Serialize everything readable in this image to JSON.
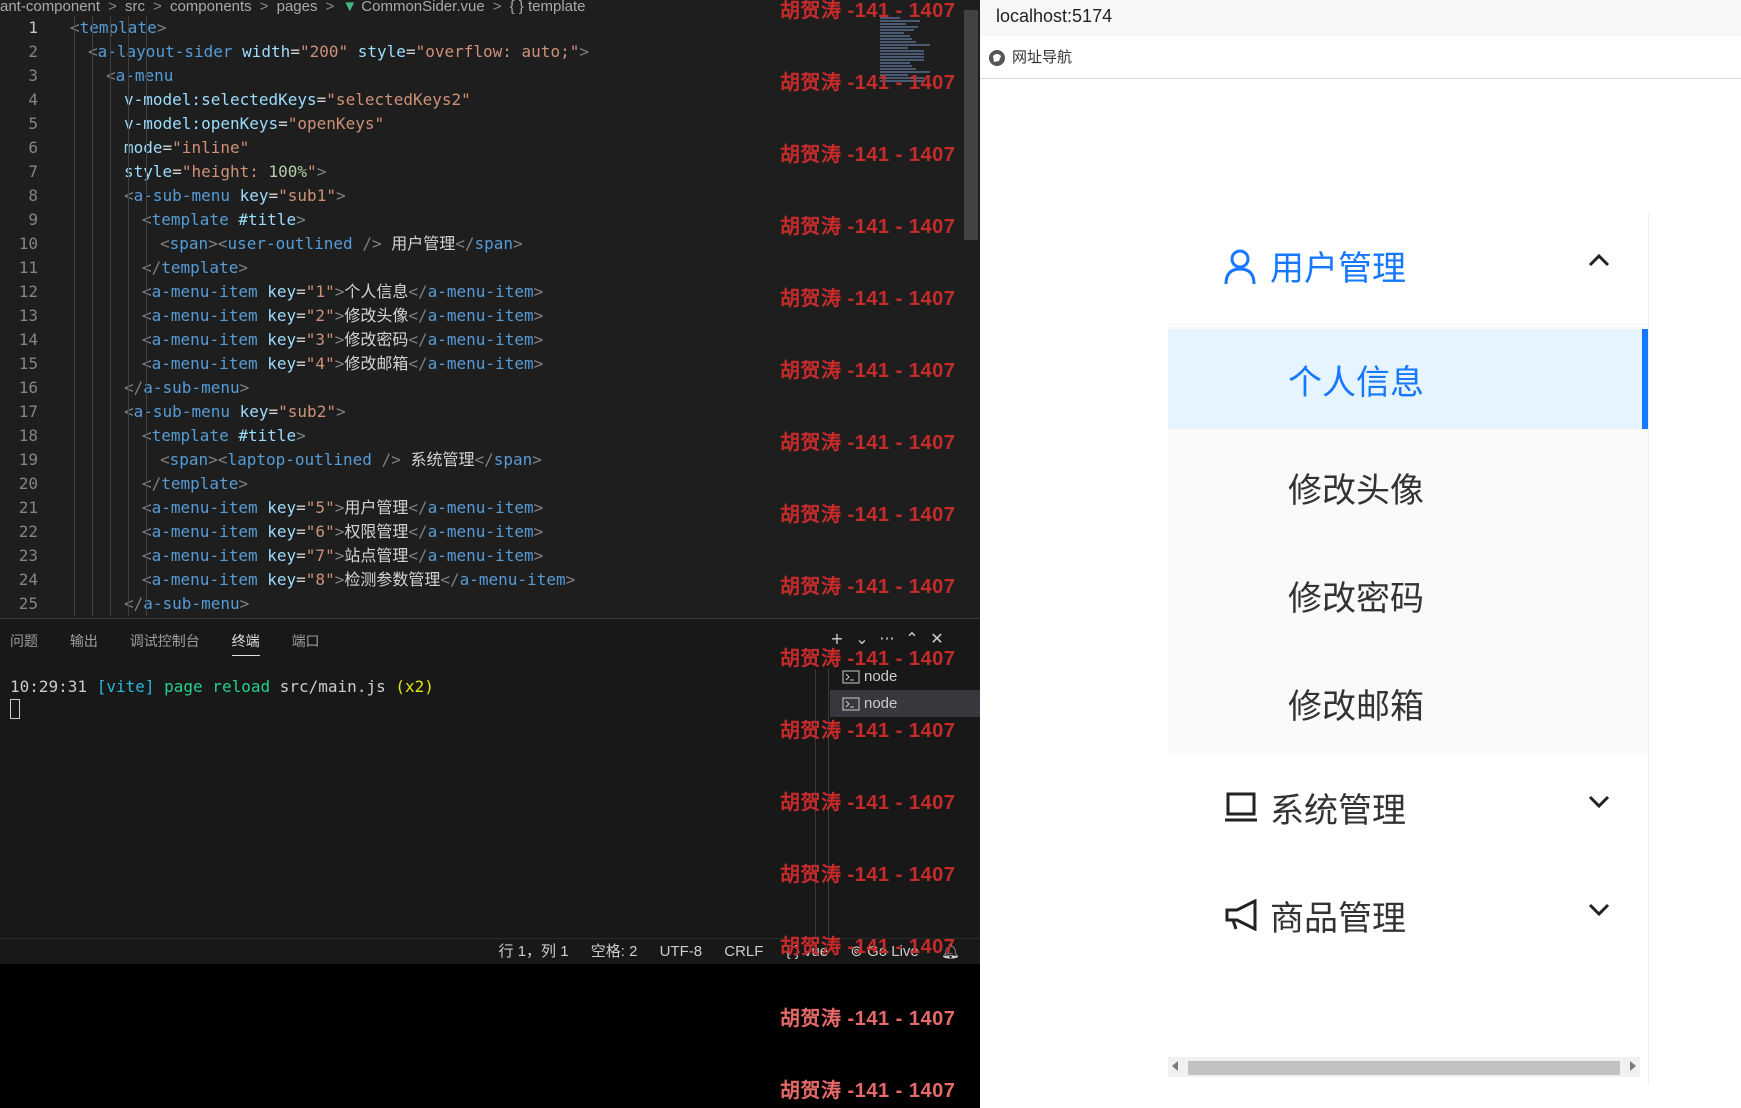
{
  "editor": {
    "breadcrumb": [
      "ant-component",
      "src",
      "components",
      "pages",
      "CommonSider.vue",
      "{ } template"
    ],
    "lines": [
      [
        [
          "b",
          "<"
        ],
        [
          "t",
          "template"
        ],
        [
          "b",
          ">"
        ]
      ],
      [
        [
          "b",
          "<"
        ],
        [
          "t",
          "a-layout-sider"
        ],
        [
          "x",
          " "
        ],
        [
          "a",
          "width"
        ],
        [
          "x",
          "="
        ],
        [
          "s",
          "\"200\""
        ],
        [
          "x",
          " "
        ],
        [
          "a",
          "style"
        ],
        [
          "x",
          "="
        ],
        [
          "s",
          "\"overflow: auto;\""
        ],
        [
          "b",
          ">"
        ]
      ],
      [
        [
          "b",
          "<"
        ],
        [
          "t",
          "a-menu"
        ]
      ],
      [
        [
          "a",
          "v-model:selectedKeys"
        ],
        [
          "x",
          "="
        ],
        [
          "s",
          "\"selectedKeys2\""
        ]
      ],
      [
        [
          "a",
          "v-model:openKeys"
        ],
        [
          "x",
          "="
        ],
        [
          "s",
          "\"openKeys\""
        ]
      ],
      [
        [
          "a",
          "mode"
        ],
        [
          "x",
          "="
        ],
        [
          "s",
          "\"inline\""
        ]
      ],
      [
        [
          "a",
          "style"
        ],
        [
          "x",
          "="
        ],
        [
          "s",
          "\"height: "
        ],
        [
          "n",
          "100%"
        ],
        [
          "s",
          "\""
        ],
        [
          "b",
          ">"
        ]
      ],
      [
        [
          "b",
          "<"
        ],
        [
          "t",
          "a-sub-menu"
        ],
        [
          "x",
          " "
        ],
        [
          "a",
          "key"
        ],
        [
          "x",
          "="
        ],
        [
          "s",
          "\"sub1\""
        ],
        [
          "b",
          ">"
        ]
      ],
      [
        [
          "b",
          "<"
        ],
        [
          "t",
          "template"
        ],
        [
          "x",
          " "
        ],
        [
          "a",
          "#title"
        ],
        [
          "b",
          ">"
        ]
      ],
      [
        [
          "b",
          "<"
        ],
        [
          "t",
          "span"
        ],
        [
          "b",
          "><"
        ],
        [
          "t",
          "user-outlined"
        ],
        [
          "x",
          " "
        ],
        [
          "b",
          "/>"
        ],
        [
          "x",
          " 用户管理"
        ],
        [
          "b",
          "</"
        ],
        [
          "t",
          "span"
        ],
        [
          "b",
          ">"
        ]
      ],
      [
        [
          "b",
          "</"
        ],
        [
          "t",
          "template"
        ],
        [
          "b",
          ">"
        ]
      ],
      [
        [
          "b",
          "<"
        ],
        [
          "t",
          "a-menu-item"
        ],
        [
          "x",
          " "
        ],
        [
          "a",
          "key"
        ],
        [
          "x",
          "="
        ],
        [
          "s",
          "\"1\""
        ],
        [
          "b",
          ">"
        ],
        [
          "x",
          "个人信息"
        ],
        [
          "b",
          "</"
        ],
        [
          "t",
          "a-menu-item"
        ],
        [
          "b",
          ">"
        ]
      ],
      [
        [
          "b",
          "<"
        ],
        [
          "t",
          "a-menu-item"
        ],
        [
          "x",
          " "
        ],
        [
          "a",
          "key"
        ],
        [
          "x",
          "="
        ],
        [
          "s",
          "\"2\""
        ],
        [
          "b",
          ">"
        ],
        [
          "x",
          "修改头像"
        ],
        [
          "b",
          "</"
        ],
        [
          "t",
          "a-menu-item"
        ],
        [
          "b",
          ">"
        ]
      ],
      [
        [
          "b",
          "<"
        ],
        [
          "t",
          "a-menu-item"
        ],
        [
          "x",
          " "
        ],
        [
          "a",
          "key"
        ],
        [
          "x",
          "="
        ],
        [
          "s",
          "\"3\""
        ],
        [
          "b",
          ">"
        ],
        [
          "x",
          "修改密码"
        ],
        [
          "b",
          "</"
        ],
        [
          "t",
          "a-menu-item"
        ],
        [
          "b",
          ">"
        ]
      ],
      [
        [
          "b",
          "<"
        ],
        [
          "t",
          "a-menu-item"
        ],
        [
          "x",
          " "
        ],
        [
          "a",
          "key"
        ],
        [
          "x",
          "="
        ],
        [
          "s",
          "\"4\""
        ],
        [
          "b",
          ">"
        ],
        [
          "x",
          "修改邮箱"
        ],
        [
          "b",
          "</"
        ],
        [
          "t",
          "a-menu-item"
        ],
        [
          "b",
          ">"
        ]
      ],
      [
        [
          "b",
          "</"
        ],
        [
          "t",
          "a-sub-menu"
        ],
        [
          "b",
          ">"
        ]
      ],
      [
        [
          "b",
          "<"
        ],
        [
          "t",
          "a-sub-menu"
        ],
        [
          "x",
          " "
        ],
        [
          "a",
          "key"
        ],
        [
          "x",
          "="
        ],
        [
          "s",
          "\"sub2\""
        ],
        [
          "b",
          ">"
        ]
      ],
      [
        [
          "b",
          "<"
        ],
        [
          "t",
          "template"
        ],
        [
          "x",
          " "
        ],
        [
          "a",
          "#title"
        ],
        [
          "b",
          ">"
        ]
      ],
      [
        [
          "b",
          "<"
        ],
        [
          "t",
          "span"
        ],
        [
          "b",
          "><"
        ],
        [
          "t",
          "laptop-outlined"
        ],
        [
          "x",
          " "
        ],
        [
          "b",
          "/>"
        ],
        [
          "x",
          " 系统管理"
        ],
        [
          "b",
          "</"
        ],
        [
          "t",
          "span"
        ],
        [
          "b",
          ">"
        ]
      ],
      [
        [
          "b",
          "</"
        ],
        [
          "t",
          "template"
        ],
        [
          "b",
          ">"
        ]
      ],
      [
        [
          "b",
          "<"
        ],
        [
          "t",
          "a-menu-item"
        ],
        [
          "x",
          " "
        ],
        [
          "a",
          "key"
        ],
        [
          "x",
          "="
        ],
        [
          "s",
          "\"5\""
        ],
        [
          "b",
          ">"
        ],
        [
          "x",
          "用户管理"
        ],
        [
          "b",
          "</"
        ],
        [
          "t",
          "a-menu-item"
        ],
        [
          "b",
          ">"
        ]
      ],
      [
        [
          "b",
          "<"
        ],
        [
          "t",
          "a-menu-item"
        ],
        [
          "x",
          " "
        ],
        [
          "a",
          "key"
        ],
        [
          "x",
          "="
        ],
        [
          "s",
          "\"6\""
        ],
        [
          "b",
          ">"
        ],
        [
          "x",
          "权限管理"
        ],
        [
          "b",
          "</"
        ],
        [
          "t",
          "a-menu-item"
        ],
        [
          "b",
          ">"
        ]
      ],
      [
        [
          "b",
          "<"
        ],
        [
          "t",
          "a-menu-item"
        ],
        [
          "x",
          " "
        ],
        [
          "a",
          "key"
        ],
        [
          "x",
          "="
        ],
        [
          "s",
          "\"7\""
        ],
        [
          "b",
          ">"
        ],
        [
          "x",
          "站点管理"
        ],
        [
          "b",
          "</"
        ],
        [
          "t",
          "a-menu-item"
        ],
        [
          "b",
          ">"
        ]
      ],
      [
        [
          "b",
          "<"
        ],
        [
          "t",
          "a-menu-item"
        ],
        [
          "x",
          " "
        ],
        [
          "a",
          "key"
        ],
        [
          "x",
          "="
        ],
        [
          "s",
          "\"8\""
        ],
        [
          "b",
          ">"
        ],
        [
          "x",
          "检测参数管理"
        ],
        [
          "b",
          "</"
        ],
        [
          "t",
          "a-menu-item"
        ],
        [
          "b",
          ">"
        ]
      ],
      [
        [
          "b",
          "</"
        ],
        [
          "t",
          "a-sub-menu"
        ],
        [
          "b",
          ">"
        ]
      ]
    ],
    "line_numbers": [
      "1",
      "2",
      "3",
      "4",
      "5",
      "6",
      "7",
      "8",
      "9",
      "10",
      "11",
      "12",
      "13",
      "14",
      "15",
      "16",
      "17",
      "18",
      "19",
      "20",
      "21",
      "22",
      "23",
      "24",
      "25"
    ],
    "active_line": "1",
    "indent_levels": [
      0,
      1,
      2,
      3,
      3,
      3,
      3,
      3,
      4,
      5,
      4,
      4,
      4,
      4,
      4,
      3,
      3,
      4,
      5,
      4,
      4,
      4,
      4,
      4,
      3
    ]
  },
  "watermark": "胡贺涛 -141 - 1407",
  "panel": {
    "tabs": [
      "问题",
      "输出",
      "调试控制台",
      "终端",
      "端口"
    ],
    "active_tab": "终端",
    "actions": [
      "+",
      "⌄",
      "···",
      "⌃",
      "✕"
    ],
    "terminal": {
      "time": "10:29:31",
      "tag": "[vite]",
      "msg": "page reload",
      "path": "src/main.js",
      "count": "(x2)"
    },
    "terminals": [
      "node",
      "node"
    ]
  },
  "statusbar": {
    "position": "行 1，列 1",
    "spaces": "空格: 2",
    "encoding": "UTF-8",
    "eol": "CRLF",
    "language": "vue",
    "golive": "Go Live"
  },
  "browser": {
    "address": "localhost:5174",
    "bookmark": "网址导航",
    "accent": "#1677ff"
  },
  "menu": {
    "sub1": {
      "title": "用户管理",
      "icon": "user-icon",
      "open": true
    },
    "sub1_items": [
      "个人信息",
      "修改头像",
      "修改密码",
      "修改邮箱"
    ],
    "selected_item": "个人信息",
    "sub2": {
      "title": "系统管理",
      "icon": "laptop-icon",
      "open": false
    },
    "sub3": {
      "title": "商品管理",
      "icon": "notification-icon",
      "open": false
    }
  }
}
